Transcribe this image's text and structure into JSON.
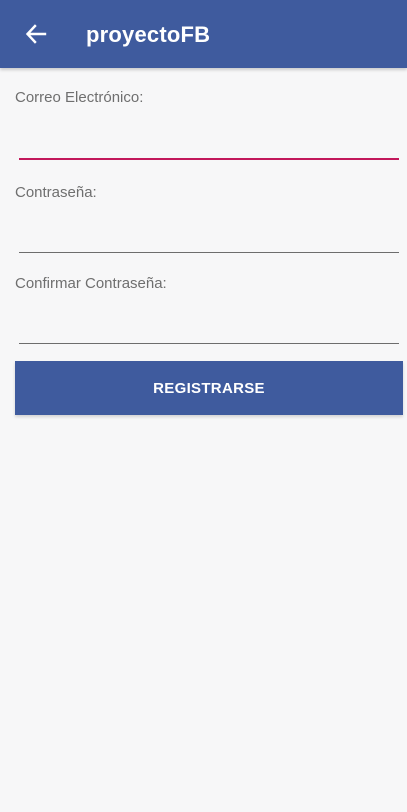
{
  "appbar": {
    "title": "proyectoFB",
    "back_icon": "arrow-left-icon",
    "color": "#3f5b9e"
  },
  "form": {
    "email": {
      "label": "Correo Electrónico:",
      "value": "",
      "focused": true
    },
    "password": {
      "label": "Contraseña:",
      "value": ""
    },
    "confirm_password": {
      "label": "Confirmar Contraseña:",
      "value": ""
    },
    "submit_label": "REGISTRARSE"
  },
  "colors": {
    "primary": "#3f5b9e",
    "focus_underline": "#c2185b",
    "background": "#f7f7f8"
  }
}
